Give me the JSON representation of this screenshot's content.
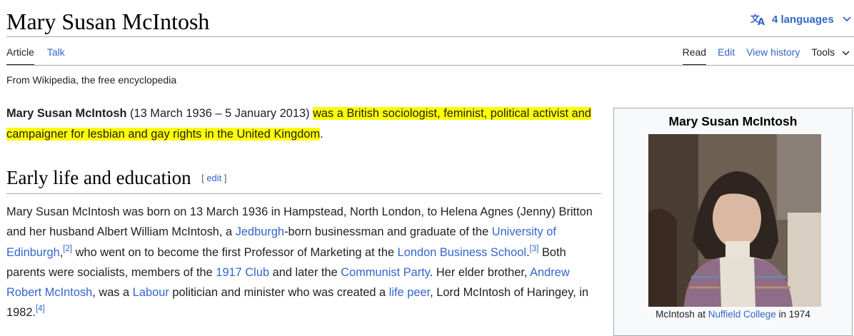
{
  "header": {
    "title": "Mary Susan McIntosh",
    "languages_label": "4 languages"
  },
  "tabs": {
    "left": [
      "Article",
      "Talk"
    ],
    "right": [
      "Read",
      "Edit",
      "View history",
      "Tools"
    ]
  },
  "tagline": "From Wikipedia, the free encyclopedia",
  "intro": {
    "bold_name": "Mary Susan McIntosh",
    "dates": " (13 March 1936 – 5 January 2013) ",
    "highlighted": "was a British sociologist, feminist, political activist and campaigner for lesbian and gay rights in the United Kingdom",
    "end": "."
  },
  "section": {
    "heading": "Early life and education",
    "edit_open": "[ ",
    "edit_label": "edit",
    "edit_close": " ]"
  },
  "para2": {
    "t1": "Mary Susan McIntosh was born on 13 March 1936 in Hampstead, North London, to Helena Agnes (Jenny) Britton and her husband Albert William McIntosh, a ",
    "l_jedburgh": "Jedburgh",
    "t2": "-born businessman and graduate of the ",
    "l_edinburgh": "University of Edinburgh",
    "t3": ",",
    "ref2": "[2]",
    "t4": " who went on to become the first Professor of Marketing at the ",
    "l_lbs": "London Business School",
    "t5": ".",
    "ref3": "[3]",
    "t6": " Both parents were socialists, members of the ",
    "l_1917": "1917 Club",
    "t7": " and later the ",
    "l_cp": "Communist Party",
    "t8": ". Her elder brother, ",
    "l_arm": "Andrew Robert McIntosh",
    "t9": ", was a ",
    "l_labour": "Labour",
    "t10": " politician and minister who was created a ",
    "l_lifepeer": "life peer",
    "t11": ", Lord McIntosh of Haringey, in 1982.",
    "ref4": "[4]"
  },
  "infobox": {
    "title": "Mary Susan McIntosh",
    "caption_pre": "McIntosh at ",
    "caption_link": "Nuffield College",
    "caption_post": " in 1974"
  },
  "colors": {
    "link": "#3366cc",
    "highlight": "#ffff00",
    "rule": "#a2a9b1",
    "infobox_bg": "#f8f9fa"
  }
}
